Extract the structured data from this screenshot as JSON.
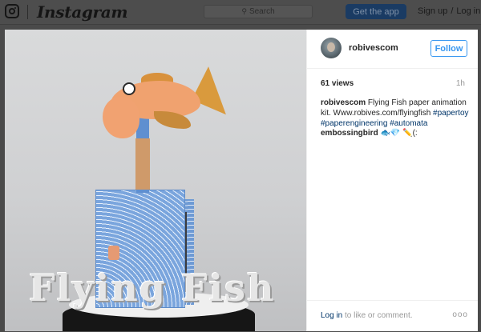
{
  "topbar": {
    "brand": "Instagram",
    "search_placeholder": "Search",
    "get_app": "Get the app",
    "sign_up": "Sign up",
    "separator": "/",
    "log_in": "Log in"
  },
  "post": {
    "overlay_title": "Flying Fish",
    "username": "robivescom",
    "follow": "Follow",
    "views": "61 views",
    "age": "1h",
    "caption": {
      "author": "robivescom",
      "text": "Flying Fish paper animation kit. Www.robives.com/flyingfish",
      "tags": [
        "#papertoy",
        "#paperengineering",
        "#automata"
      ]
    },
    "comment": {
      "author": "embossingbird",
      "text": "🐟💎 ✏️(:"
    },
    "footer": {
      "login_link": "Log in",
      "login_text": "to like or comment.",
      "more": "ooo"
    }
  },
  "colors": {
    "accent": "#3897f0",
    "link": "#003569",
    "get_app_bg": "#1a3b63"
  }
}
